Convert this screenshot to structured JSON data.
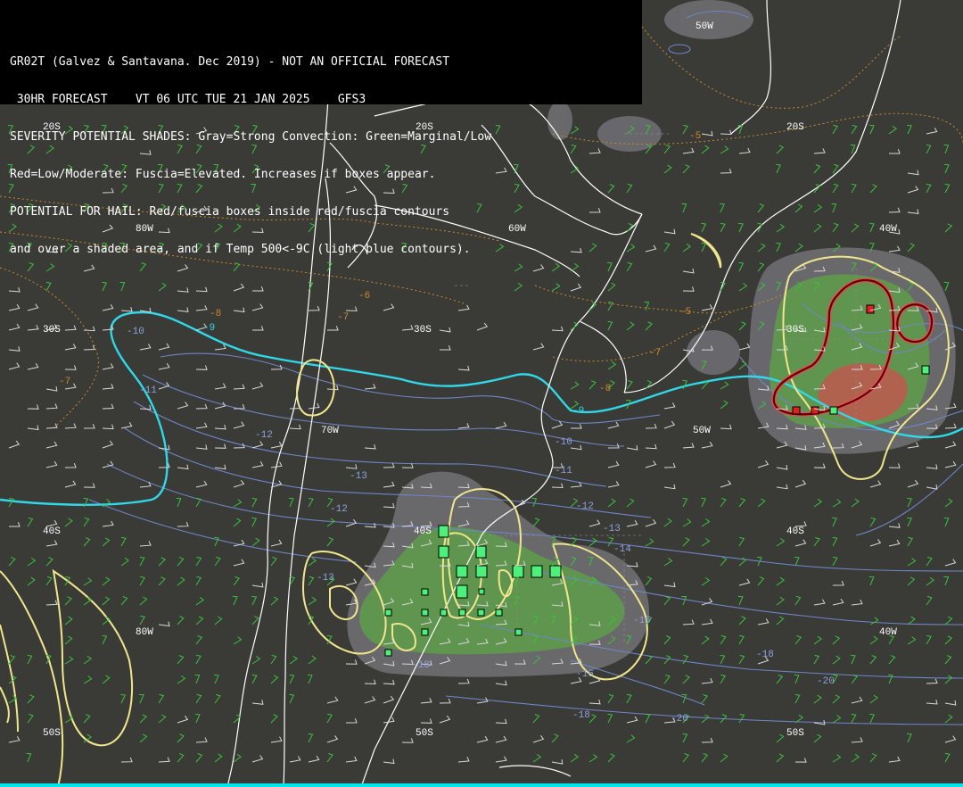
{
  "header": {
    "line1": "GR02T (Galvez & Santavana. Dec 2019) - NOT AN OFFICIAL FORECAST",
    "line2": " 30HR FORECAST    VT 06 UTC TUE 21 JAN 2025    GFS3",
    "line3": "SEVERITY POTENTIAL SHADES: Gray=Strong Convection: Green=Marginal/Low",
    "line4": "Red=Low/Moderate: Fuscia=Elevated. Increases if boxes appear.",
    "line5": "POTENTIAL FOR HAIL: Red/fuscia boxes inside red/fuscia contours",
    "line6": "and over a shaded area, and if Temp 500<-9C (light blue contours)."
  },
  "grid_labels": {
    "lat20_a": "20S",
    "lat20_b": "20S",
    "lat20_c": "20S",
    "lat30_a": "30S",
    "lat30_b": "30S",
    "lat30_c": "30S",
    "lat40_a": "40S",
    "lat40_b": "40S",
    "lat40_c": "40S",
    "lat50_a": "50S",
    "lat50_b": "50S",
    "lat50_c": "50S",
    "lon80_a": "80W",
    "lon80_b": "80W",
    "lon70": "70W",
    "lon60": "60W",
    "lon50_a": "50W",
    "lon50_b": "50W",
    "lon40_a": "40W",
    "lon40_b": "40W"
  },
  "contour_labels": {
    "t_m5_a": "-5",
    "t_m5_b": "-5",
    "t_m6": "-6",
    "t_m7_a": "-7",
    "t_m7_b": "-7",
    "t_m7_c": "-7",
    "t_m8": "-8",
    "t_m9_a": "-9",
    "t_m9_b": "-9",
    "t_m10_a": "-10",
    "t_m10_b": "-10",
    "t_m11_a": "-11",
    "t_m11_b": "-11",
    "t_m12_a": "-12",
    "t_m12_b": "-12",
    "t_m12_c": "-12",
    "t_m13_a": "-13",
    "t_m13_b": "-13",
    "t_m13_c": "-13",
    "t_m14": "-14",
    "t_m16_a": "-16",
    "t_m16_b": "-16",
    "t_m18_a": "-18",
    "t_m18_b": "-18",
    "t_m18_c": "-18",
    "t_m20_a": "-20",
    "t_m20_b": "-20",
    "o_m8": "-8"
  },
  "colors": {
    "background": "#3a3a37",
    "shade_gray": "#6b6b6f",
    "shade_green": "#5e9a4c",
    "shade_red": "#c0594f",
    "coast": "#ffffff",
    "contour_yellow": "#f0e68c",
    "contour_cyan": "#30d8e8",
    "contour_blue": "#6f86c6",
    "contour_orange": "#c98a2a",
    "hail_red": "#8b0000",
    "box_green": "#4cf07a",
    "box_red": "#e02020",
    "wind_green": "#3cc23c",
    "wind_white": "#d8d8d8"
  }
}
